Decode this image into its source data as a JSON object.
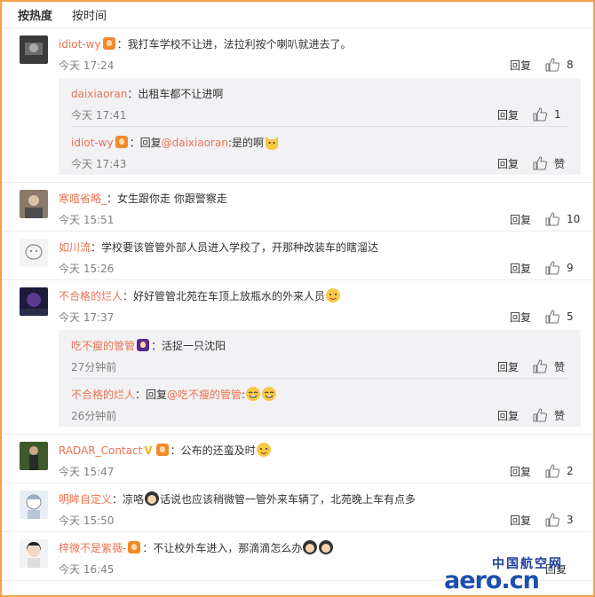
{
  "tabs": [
    "按热度",
    "按时间"
  ],
  "comments": [
    {
      "user": "idiot-wy",
      "text": "：我打车学校不让进，法拉利按个喇叭就进去了。",
      "time": "今天 17:24",
      "reply_label": "回复",
      "likes": "8",
      "replies": [
        {
          "user": "daixiaoran",
          "text": "：出租车都不让进啊",
          "time": "今天 17:41",
          "reply_label": "回复",
          "likes": "1"
        },
        {
          "user": "idiot-wy",
          "text_pre": "：回复",
          "mention": "@daixiaoran",
          "text": ":是的啊",
          "time": "今天 17:43",
          "reply_label": "回复",
          "likes": "赞"
        }
      ]
    },
    {
      "user": "寒暄省略_",
      "text": "：女生跟你走 你跟警察走",
      "time": "今天 15:51",
      "reply_label": "回复",
      "likes": "10"
    },
    {
      "user": "如川流",
      "text": "：学校要该管管外部人员进入学校了，开那种改装车的瞎溜达",
      "time": "今天 15:26",
      "reply_label": "回复",
      "likes": "9"
    },
    {
      "user": "不合格的烂人",
      "text": "：好好管管北苑在车顶上放瓶水的外来人员",
      "time": "今天 17:37",
      "reply_label": "回复",
      "likes": "5",
      "replies": [
        {
          "user": "吃不瘦的管管",
          "text": "：活捉一只沈阳",
          "time": "27分钟前",
          "reply_label": "回复",
          "likes": "赞"
        },
        {
          "user": "不合格的烂人",
          "text_pre": "：回复",
          "mention": "@吃不瘦的管管",
          "text": ":",
          "time": "26分钟前",
          "reply_label": "回复",
          "likes": "赞"
        }
      ]
    },
    {
      "user": "RADAR_Contact",
      "text": "：公布的还蛮及时",
      "time": "今天 15:47",
      "reply_label": "回复",
      "likes": "2"
    },
    {
      "user": "明眸自定义",
      "text": "：凉咯",
      "text2": "话说也应该稍微管一管外来车辆了，北苑晚上车有点多",
      "time": "今天 15:50",
      "reply_label": "回复",
      "likes": "3"
    },
    {
      "user": "梓微不是紫薇-",
      "text": "：不让校外车进入，那滴滴怎么办",
      "time": "今天 16:45",
      "reply_label": "回复",
      "likes": ""
    }
  ],
  "watermark": {
    "top": "中国航空网",
    "main": "aero.cn"
  },
  "colors": {
    "username": "#eb7350",
    "border": "#f6a04b",
    "reply_bg": "#f2f2f5"
  }
}
